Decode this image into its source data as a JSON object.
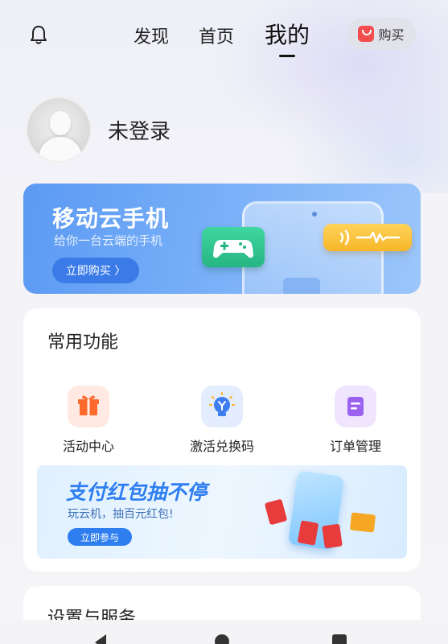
{
  "topbar": {
    "tabs": [
      "发现",
      "首页",
      "我的"
    ],
    "active_tab": "我的",
    "buy_label": "购买"
  },
  "profile": {
    "name": "未登录"
  },
  "banner": {
    "title": "移动云手机",
    "subtitle": "给你一台云端的手机",
    "button": "立即购买 〉"
  },
  "common": {
    "title": "常用功能",
    "items": [
      {
        "label": "活动中心",
        "icon": "gift-icon",
        "color": "#ff6a2c"
      },
      {
        "label": "激活兑换码",
        "icon": "lightbulb-icon",
        "color": "#3d7df0"
      },
      {
        "label": "订单管理",
        "icon": "document-icon",
        "color": "#9b62f0"
      }
    ],
    "promo": {
      "title": "支付红包抽不停",
      "subtitle": "玩云机，抽百元红包!",
      "button": "立即参与"
    }
  },
  "settings": {
    "title": "设置与服务"
  },
  "colors": {
    "accent": "#2f7ef0",
    "buy_red": "#f44d4d",
    "game_green": "#26b583",
    "sound_yellow": "#f7b628"
  }
}
